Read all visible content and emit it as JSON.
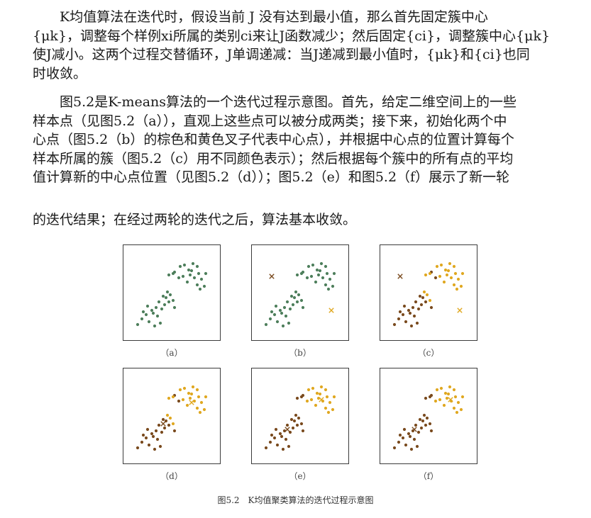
{
  "paragraph1": {
    "lines": [
      "K均值算法在迭代时，假设当前  J  没有达到最小值，那么首先固定簇中心",
      "{μk}，调整每个样例xi所属的类别ci来让J函数减少；然后固定{ci}，调整簇中心{μk}",
      "使J减小。这两个过程交替循环，J单调递减：当J递减到最小值时，{μk}和{ci}也同",
      "时收敛。"
    ]
  },
  "paragraph2": {
    "lines": [
      "图5.2是K-means算法的一个迭代过程示意图。首先，给定二维空间上的一些",
      "样本点（见图5.2（a）），直观上这些点可以被分成两类；接下来，初始化两个中",
      "心点（图5.2（b）的棕色和黄色叉子代表中心点），并根据中心点的位置计算每个",
      "样本所属的簇（图5.2（c）用不同颜色表示）；然后根据每个簇中的所有点的平均",
      "值计算新的中心点位置（见图5.2（d））；图5.2（e）和图5.2（f）展示了新一轮"
    ]
  },
  "paragraph3": {
    "lines": [
      "的迭代结果；在经过两轮的迭代之后，算法基本收敛。"
    ]
  },
  "figure": {
    "caption": "图5.2　K均值聚类算法的迭代过程示意图",
    "colors": {
      "green": "#4e7f5c",
      "brown": "#7a4b1f",
      "yellow": "#e0a821",
      "border": "#3b3b3b"
    },
    "panels": [
      {
        "label": "（a）",
        "state": "all-green",
        "centers": []
      },
      {
        "label": "（b）",
        "state": "all-green",
        "centers": [
          "brown",
          "yellow"
        ]
      },
      {
        "label": "（c）",
        "state": "assigned-initial",
        "centers": [
          "brown",
          "yellow"
        ]
      },
      {
        "label": "（d）",
        "state": "assigned-initial",
        "centers": [
          "brown",
          "yellow"
        ]
      },
      {
        "label": "（e）",
        "state": "assigned-final",
        "centers": [
          "brown",
          "yellow"
        ]
      },
      {
        "label": "（f）",
        "state": "assigned-final",
        "centers": [
          "brown",
          "yellow"
        ]
      }
    ],
    "marker_icon": "cross-icon"
  }
}
